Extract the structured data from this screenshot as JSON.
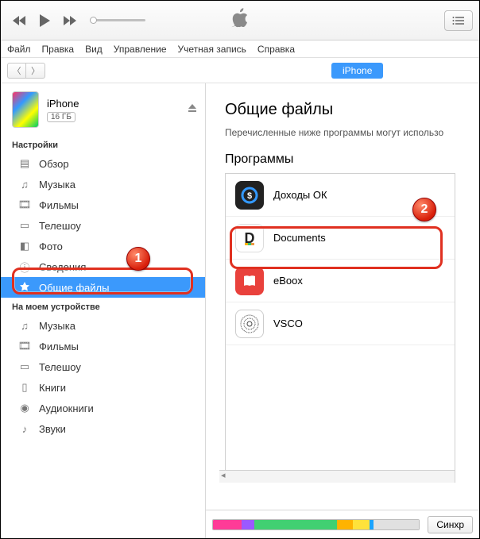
{
  "menu": [
    "Файл",
    "Правка",
    "Вид",
    "Управление",
    "Учетная запись",
    "Справка"
  ],
  "nav": {
    "device_pill": "iPhone"
  },
  "device": {
    "name": "iPhone",
    "capacity": "16 ГБ"
  },
  "sidebar": {
    "settings_title": "Настройки",
    "settings": [
      {
        "label": "Обзор",
        "icon": "summary"
      },
      {
        "label": "Музыка",
        "icon": "music"
      },
      {
        "label": "Фильмы",
        "icon": "film"
      },
      {
        "label": "Телешоу",
        "icon": "tv"
      },
      {
        "label": "Фото",
        "icon": "photo"
      },
      {
        "label": "Сведения",
        "icon": "info"
      },
      {
        "label": "Общие файлы",
        "icon": "apps",
        "selected": true
      }
    ],
    "device_title": "На моем устройстве",
    "device_items": [
      {
        "label": "Музыка",
        "icon": "music"
      },
      {
        "label": "Фильмы",
        "icon": "film"
      },
      {
        "label": "Телешоу",
        "icon": "tv"
      },
      {
        "label": "Книги",
        "icon": "book"
      },
      {
        "label": "Аудиокниги",
        "icon": "audiobook"
      },
      {
        "label": "Звуки",
        "icon": "tone"
      }
    ]
  },
  "content": {
    "title": "Общие файлы",
    "subtitle": "Перечисленные ниже программы могут использо",
    "apps_title": "Программы",
    "apps": [
      {
        "name": "Доходы ОК",
        "icon": "dohody"
      },
      {
        "name": "Documents",
        "icon": "docs",
        "highlighted": true
      },
      {
        "name": "eBoox",
        "icon": "eboox"
      },
      {
        "name": "VSCO",
        "icon": "vsco"
      }
    ]
  },
  "bottom": {
    "sync_label": "Синхр",
    "segments": [
      {
        "color": "#ff3b97",
        "w": 14
      },
      {
        "color": "#9b59ff",
        "w": 6
      },
      {
        "color": "#41d072",
        "w": 40
      },
      {
        "color": "#ffb300",
        "w": 8
      },
      {
        "color": "#ffe23b",
        "w": 8
      },
      {
        "color": "#1aa3ff",
        "w": 2
      },
      {
        "color": "#e0e0e0",
        "w": 22
      }
    ]
  },
  "annotations": {
    "badge1": "1",
    "badge2": "2"
  }
}
